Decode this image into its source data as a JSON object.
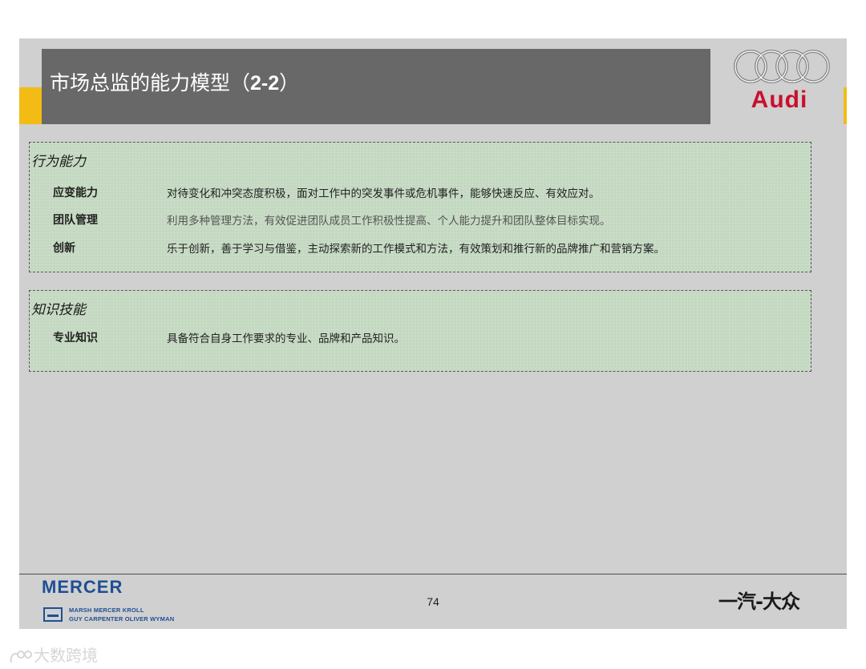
{
  "header": {
    "title_cn": "市场总监的能力模型（",
    "title_num": "2-2",
    "title_close": "）",
    "logo_word": "Audi"
  },
  "sections": [
    {
      "heading": "行为能力",
      "rows": [
        {
          "label": "应变能力",
          "desc": "对待变化和冲突态度积极，面对工作中的突发事件或危机事件，能够快速反应、有效应对。"
        },
        {
          "label": "团队管理",
          "desc": "利用多种管理方法，有效促进团队成员工作积极性提高、个人能力提升和团队整体目标实现。"
        },
        {
          "label": "创新",
          "desc": "乐于创新，善于学习与借鉴，主动探索新的工作模式和方法，有效策划和推行新的品牌推广和营销方案。"
        }
      ]
    },
    {
      "heading": "知识技能",
      "rows": [
        {
          "label": "专业知识",
          "desc": "具备符合自身工作要求的专业、品牌和产品知识。"
        }
      ]
    }
  ],
  "footer": {
    "mercer": "MERCER",
    "mercer_sub1": "MARSH  MERCER  KROLL",
    "mercer_sub2": "GUY CARPENTER  OLIVER WYMAN",
    "page_number": "74",
    "faw": "一汽-大众"
  },
  "watermark": "大数跨境",
  "colors": {
    "title_bar": "#686868",
    "accent_yellow": "#f2bc15",
    "box_green": "#c3d8c0",
    "audi_red": "#c8102e",
    "mercer_blue": "#1e4f94"
  }
}
